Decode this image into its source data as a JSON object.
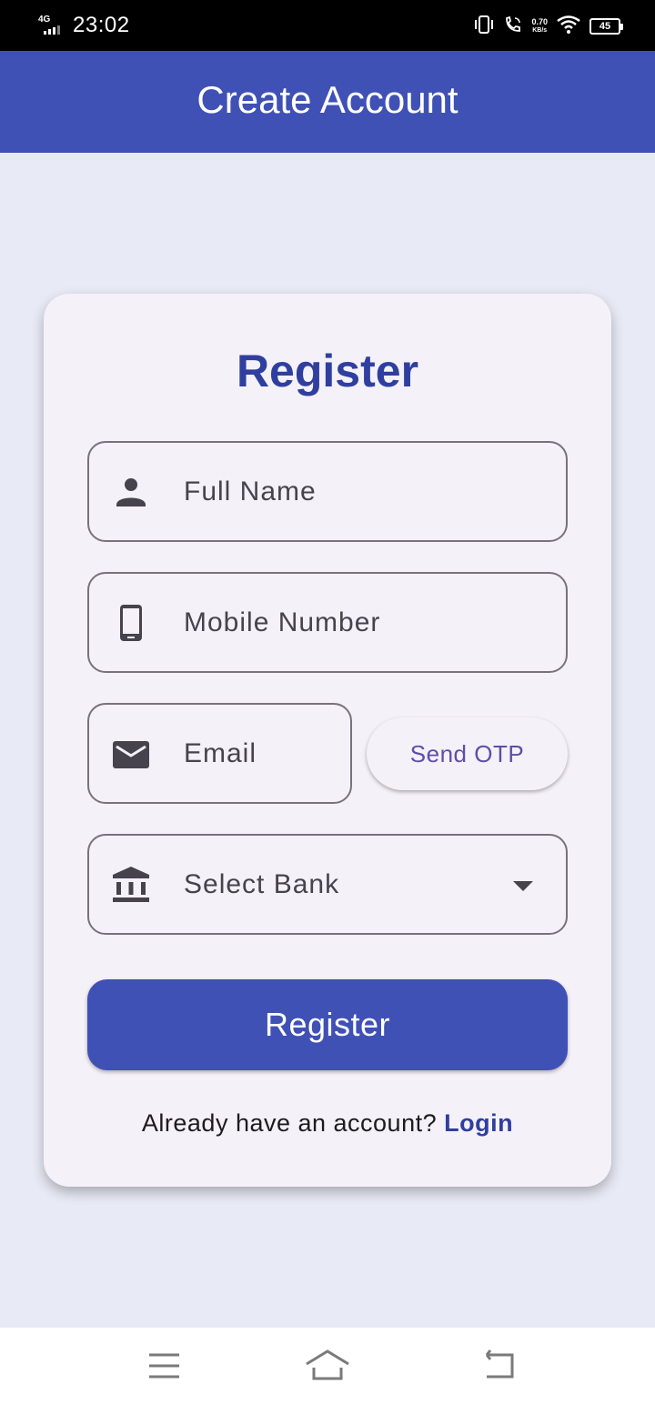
{
  "status_bar": {
    "network": "4G",
    "time": "23:02",
    "speed_value": "0.70",
    "speed_unit": "KB/s",
    "battery": "45"
  },
  "app_bar": {
    "title": "Create Account"
  },
  "form": {
    "title": "Register",
    "full_name_placeholder": "Full Name",
    "mobile_placeholder": "Mobile Number",
    "email_placeholder": "Email",
    "send_otp_label": "Send OTP",
    "bank_placeholder": "Select Bank",
    "register_label": "Register",
    "footer_prompt": "Already have an account?",
    "login_label": "Login"
  },
  "icons": {
    "full_name": "person-icon",
    "mobile": "phone-icon",
    "email": "mail-icon",
    "bank": "bank-icon",
    "dropdown": "chevron-down-icon"
  },
  "colors": {
    "primary": "#3f51b5",
    "title": "#2f3f9f",
    "background": "#e8eaf6",
    "card": "#f5f1f8"
  }
}
